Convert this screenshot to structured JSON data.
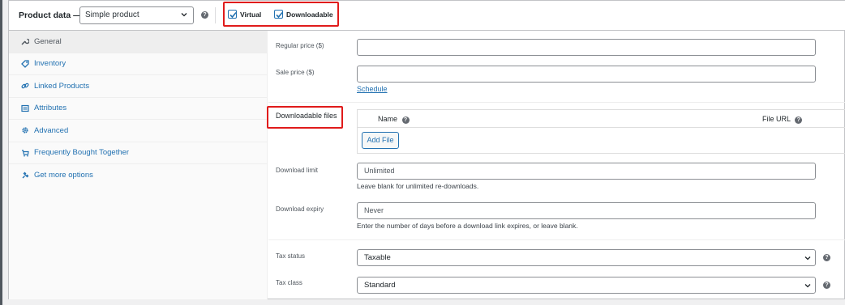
{
  "header": {
    "title": "Product data —",
    "product_type": "Simple product",
    "virtual_label": "Virtual",
    "downloadable_label": "Downloadable",
    "virtual_checked": true,
    "downloadable_checked": true
  },
  "sidebar": {
    "items": [
      {
        "label": "General",
        "icon": "wrench-icon",
        "active": true
      },
      {
        "label": "Inventory",
        "icon": "tag-icon",
        "active": false
      },
      {
        "label": "Linked Products",
        "icon": "link-icon",
        "active": false
      },
      {
        "label": "Attributes",
        "icon": "list-icon",
        "active": false
      },
      {
        "label": "Advanced",
        "icon": "gear-icon",
        "active": false
      },
      {
        "label": "Frequently Bought Together",
        "icon": "cart-icon",
        "active": false
      },
      {
        "label": "Get more options",
        "icon": "plugin-icon",
        "active": false
      }
    ]
  },
  "general": {
    "regular_price_label": "Regular price ($)",
    "regular_price_value": "",
    "sale_price_label": "Sale price ($)",
    "sale_price_value": "",
    "schedule_link": "Schedule",
    "downloadable_files_label": "Downloadable files",
    "files_col_name": "Name",
    "files_col_url": "File URL",
    "add_file_button": "Add File",
    "download_limit_label": "Download limit",
    "download_limit_placeholder": "Unlimited",
    "download_limit_hint": "Leave blank for unlimited re-downloads.",
    "download_expiry_label": "Download expiry",
    "download_expiry_placeholder": "Never",
    "download_expiry_hint": "Enter the number of days before a download link expires, or leave blank.",
    "tax_status_label": "Tax status",
    "tax_status_value": "Taxable",
    "tax_class_label": "Tax class",
    "tax_class_value": "Standard"
  },
  "colors": {
    "accent": "#2271b1",
    "highlight": "#e01b1b"
  }
}
